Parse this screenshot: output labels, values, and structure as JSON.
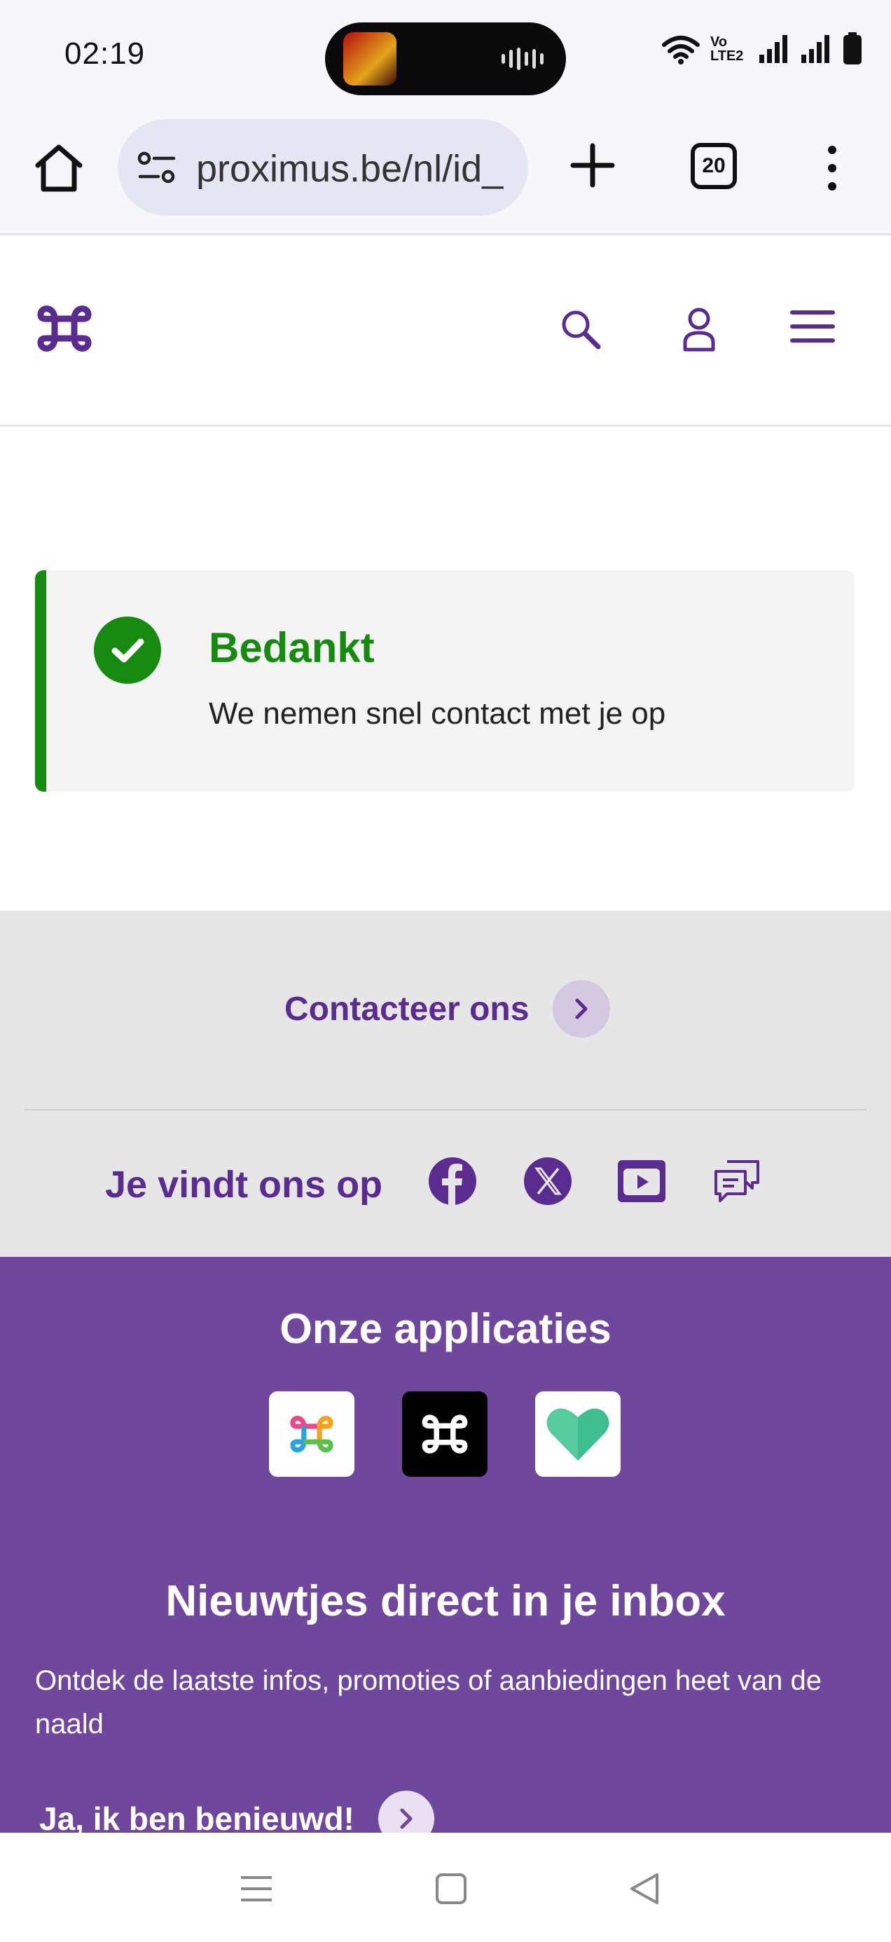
{
  "status_bar": {
    "time": "02:19",
    "icons": [
      "music-art-icon",
      "audio-wave-icon",
      "wifi-icon",
      "volte-icon",
      "signal-icon",
      "signal-icon",
      "battery-icon"
    ],
    "volte_label": "Vo LTE2"
  },
  "browser": {
    "url": "proximus.be/nl/id_",
    "tab_count": "20",
    "icons": [
      "home-icon",
      "site-settings-icon",
      "new-tab-icon",
      "more-vert-icon"
    ]
  },
  "site_header": {
    "icons": [
      "proximus-logo",
      "search-icon",
      "user-icon",
      "hamburger-menu-icon"
    ]
  },
  "confirmation": {
    "title": "Bedankt",
    "message": "We nemen snel contact met je op",
    "accent_color": "#178a12"
  },
  "contact": {
    "label": "Contacteer ons"
  },
  "social": {
    "label": "Je vindt ons op",
    "icons": [
      "facebook-icon",
      "x-twitter-icon",
      "youtube-icon",
      "community-chat-icon"
    ]
  },
  "apps": {
    "title": "Onze applicaties",
    "icons": [
      "myproximus-app-icon",
      "proximus-pickx-app-icon",
      "proximus-health-app-icon"
    ]
  },
  "newsletter": {
    "title": "Nieuwtjes direct in je inbox",
    "text": "Ontdek de laatste infos, promoties of aanbiedingen heet van de naald",
    "cta": "Ja, ik ben benieuwd!"
  },
  "colors": {
    "brand_purple": "#5b2c8f",
    "footer_purple": "#6f479c",
    "success_green": "#178a12"
  },
  "nav_bar": {
    "icons": [
      "recents-icon",
      "home-square-icon",
      "back-icon"
    ]
  }
}
